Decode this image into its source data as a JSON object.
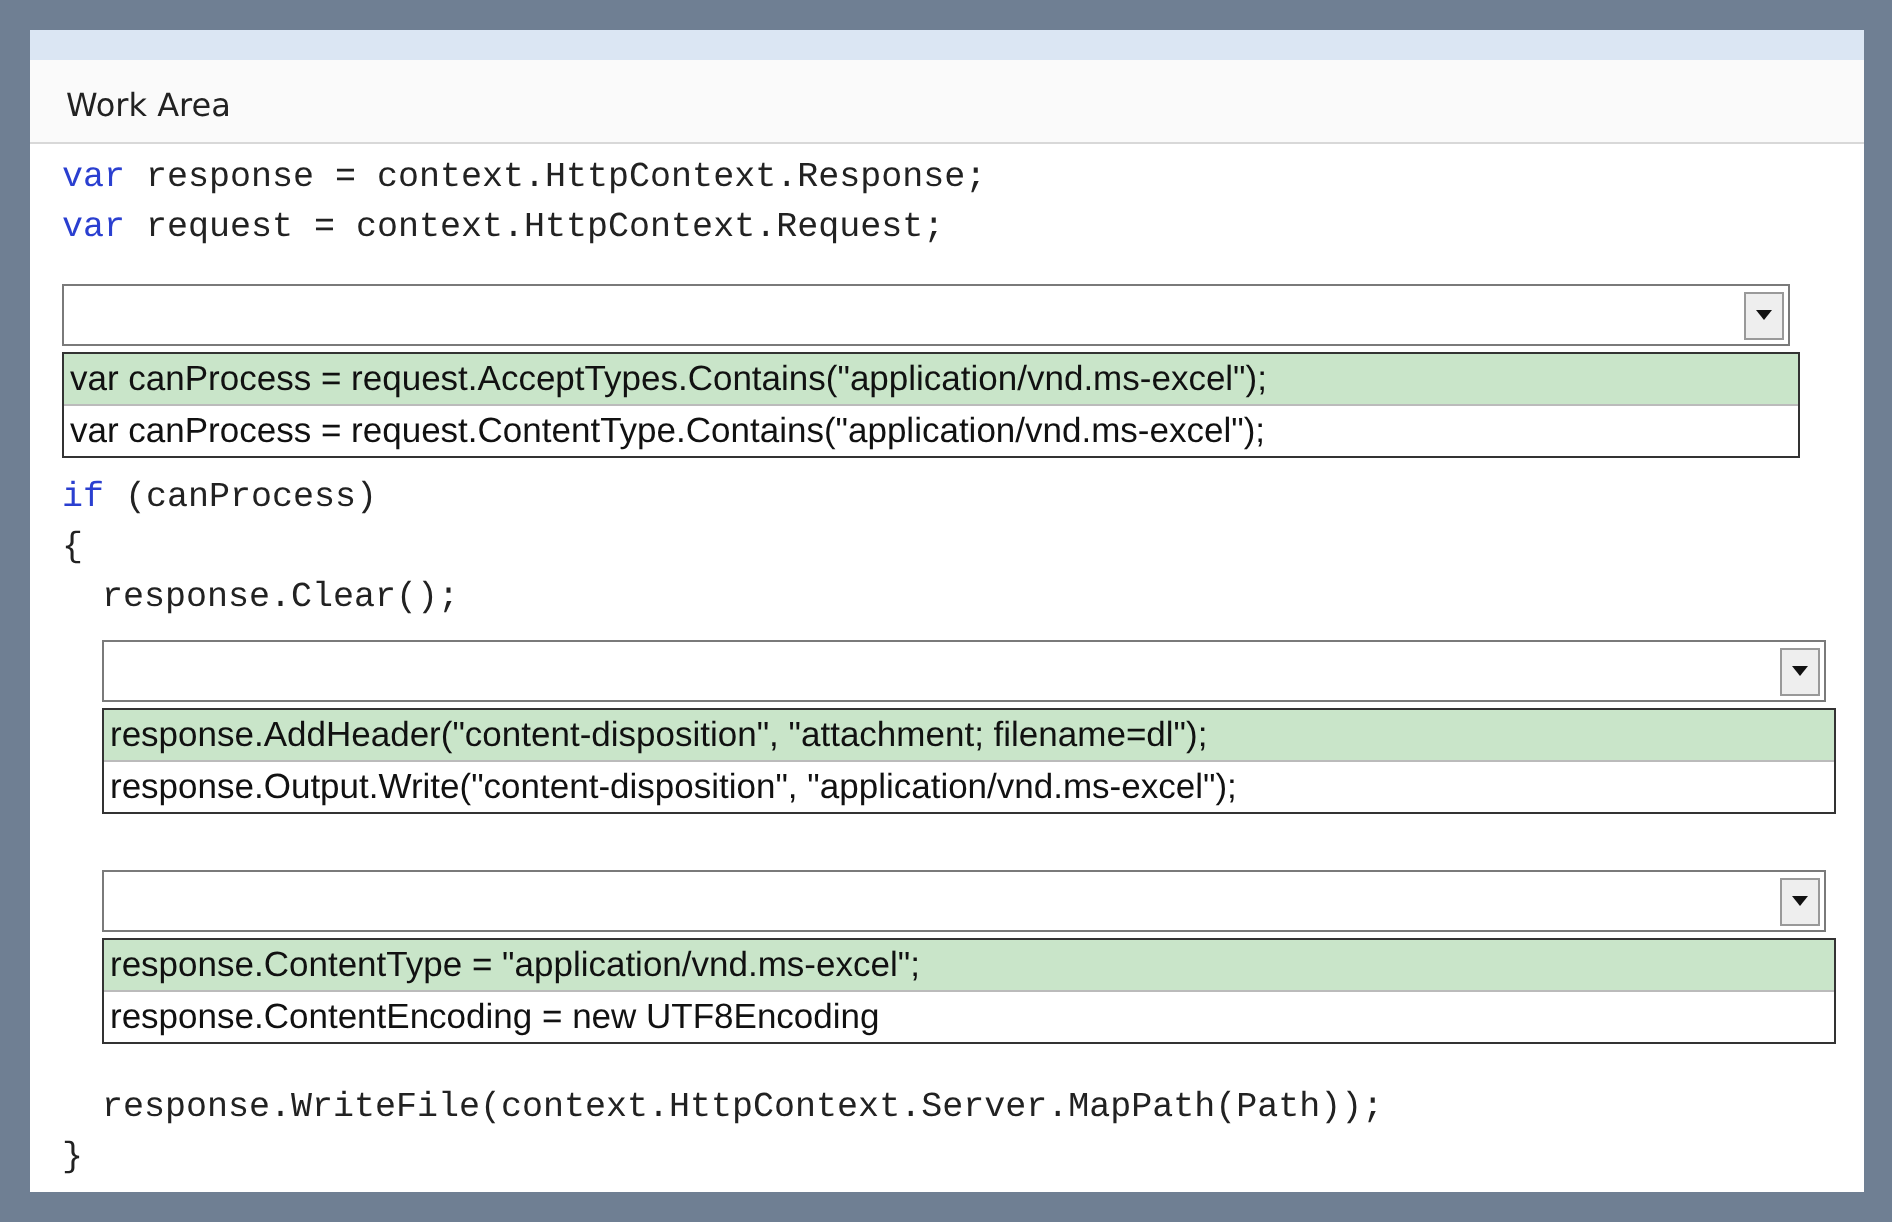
{
  "header": {
    "title": "Work Area"
  },
  "items": [
    {
      "kind": "code",
      "tokens": [
        {
          "kind": "keyword",
          "text": "var"
        },
        {
          "kind": "plain",
          "text": " response = context.HttpContext.Response;"
        }
      ]
    },
    {
      "kind": "code",
      "tokens": [
        {
          "kind": "keyword",
          "text": "var"
        },
        {
          "kind": "plain",
          "text": " request = context.HttpContext.Request;"
        }
      ]
    },
    {
      "kind": "dropdown",
      "options": [
        {
          "label": "var canProcess = request.AcceptTypes.Contains(\"application/vnd.ms-excel\");",
          "selected": true
        },
        {
          "label": "var canProcess = request.ContentType.Contains(\"application/vnd.ms-excel\");",
          "selected": false
        }
      ]
    },
    {
      "kind": "code",
      "tokens": [
        {
          "kind": "keyword",
          "text": "if"
        },
        {
          "kind": "plain",
          "text": " (canProcess)"
        }
      ]
    },
    {
      "kind": "code",
      "tokens": [
        {
          "kind": "plain",
          "text": "{"
        }
      ]
    },
    {
      "kind": "block",
      "children": [
        {
          "kind": "code",
          "tokens": [
            {
              "kind": "plain",
              "text": "response.Clear();"
            }
          ]
        },
        {
          "kind": "dropdown",
          "options": [
            {
              "label": "response.AddHeader(\"content-disposition\", \"attachment; filename=dl\");",
              "selected": true
            },
            {
              "label": "response.Output.Write(\"content-disposition\", \"application/vnd.ms-excel\");",
              "selected": false
            }
          ]
        },
        {
          "kind": "dropdown",
          "options": [
            {
              "label": "response.ContentType = \"application/vnd.ms-excel\";",
              "selected": true
            },
            {
              "label": "response.ContentEncoding = new UTF8Encoding",
              "selected": false
            }
          ]
        },
        {
          "kind": "code",
          "tokens": [
            {
              "kind": "plain",
              "text": "response.WriteFile(context.HttpContext.Server.MapPath(Path));"
            }
          ]
        }
      ]
    },
    {
      "kind": "code",
      "tokens": [
        {
          "kind": "plain",
          "text": "}"
        }
      ]
    }
  ]
}
